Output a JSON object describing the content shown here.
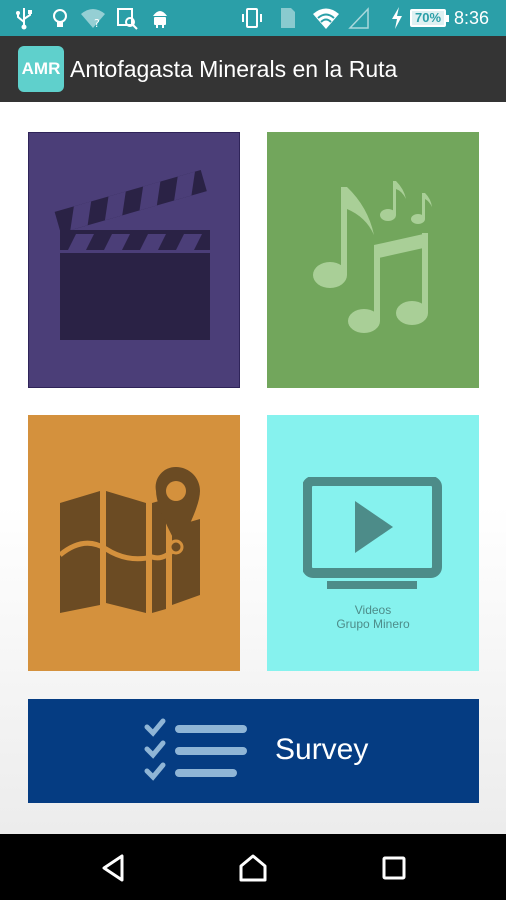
{
  "status_bar": {
    "battery": "70%",
    "time": "8:36"
  },
  "app_bar": {
    "logo_text": "AMR",
    "title": "Antofagasta Minerals en la Ruta"
  },
  "tiles": {
    "videos_line1": "Videos",
    "videos_line2": "Grupo Minero"
  },
  "survey": {
    "label": "Survey"
  },
  "colors": {
    "status_bar": "#2b9fa8",
    "app_bar": "#343434",
    "cinema_tile": "#4b3e78",
    "music_tile": "#72a65c",
    "map_tile": "#d4913d",
    "videos_tile": "#86f2ee",
    "survey_banner": "#053c82"
  },
  "icons": [
    "usb-icon",
    "bulb-icon",
    "wifi-question-icon",
    "screenshot-icon",
    "android-icon",
    "vibrate-icon",
    "sim-icon",
    "wifi-icon",
    "signal-icon",
    "charging-icon",
    "clapperboard-icon",
    "music-notes-icon",
    "map-pin-icon",
    "video-play-icon",
    "checklist-icon",
    "back-icon",
    "home-icon",
    "recents-icon"
  ]
}
